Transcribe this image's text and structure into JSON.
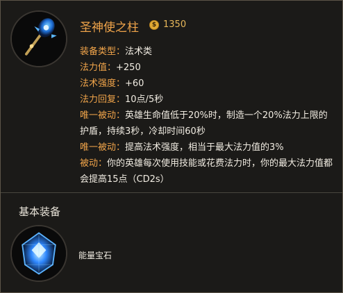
{
  "item": {
    "icon": "staff-icon",
    "name": "圣神使之柱",
    "price": "1350",
    "price_icon": "gold-coin-icon",
    "price_icon_glyph": "$",
    "attributes": [
      {
        "key": "装备类型：",
        "value": "法术类"
      },
      {
        "key": "法力值：",
        "value": "+250"
      },
      {
        "key": "法术强度：",
        "value": "+60"
      },
      {
        "key": "法力回复：",
        "value": "10点/5秒"
      },
      {
        "key": "唯一被动：",
        "value": "英雄生命值低于20%时，制造一个20%法力上限的护盾，持续3秒，冷却时间60秒"
      },
      {
        "key": "唯一被动：",
        "value": "提高法术强度，相当于最大法力值的3%"
      },
      {
        "key": "被动：",
        "value": "你的英雄每次使用技能或花费法力时，你的最大法力值都会提高15点（CD2s）"
      }
    ]
  },
  "components": {
    "title": "基本装备",
    "items": [
      {
        "icon": "energy-gem-icon",
        "name": "能量宝石"
      }
    ]
  },
  "colors": {
    "background": "#1b1a18",
    "accent": "#f0a44a",
    "text": "#f1ece2",
    "gold": "#e0a934"
  }
}
